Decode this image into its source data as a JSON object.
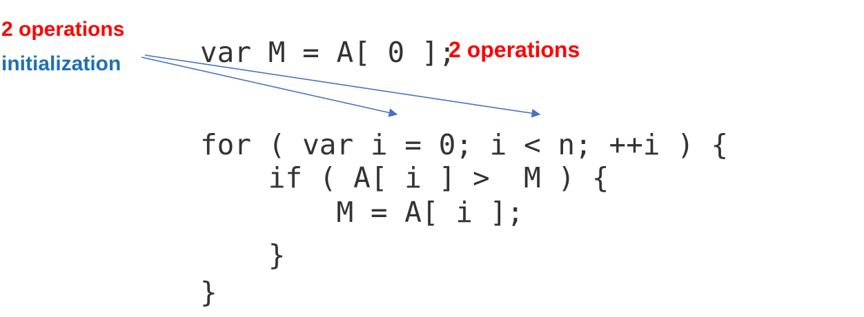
{
  "annotations": {
    "ops_top": "2 operations",
    "init": "initialization",
    "ops_line1": "2 operations"
  },
  "code": {
    "line1": "var M = A[ 0 ];",
    "line2": "for ( var i = 0; i < n; ++i ) {",
    "line3": "    if ( A[ i ] >  M ) {",
    "line4": "        M = A[ i ];",
    "line5": "    }",
    "line6": "}"
  },
  "colors": {
    "annotation_red": "#ff0000",
    "annotation_blue": "#1f6fb8",
    "arrow": "#4472c4",
    "code_text": "#333333"
  }
}
